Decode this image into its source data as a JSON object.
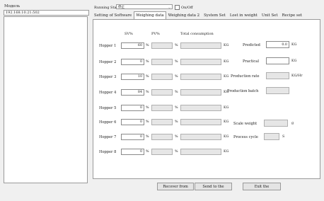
{
  "left": {
    "title": "Модель",
    "ip": "192.168.10.21:502"
  },
  "top": {
    "running_status_label": "Running Status",
    "running_status_value": "停止",
    "onoff_label": "On/Off"
  },
  "tabs": [
    {
      "label": "Setting of Software",
      "active": false
    },
    {
      "label": "Weighing data",
      "active": true
    },
    {
      "label": "Weighing data 2",
      "active": false
    },
    {
      "label": "System Set",
      "active": false
    },
    {
      "label": "Lost in weight",
      "active": false
    },
    {
      "label": "Unit Set",
      "active": false
    },
    {
      "label": "Recipe set",
      "active": false
    }
  ],
  "weighing": {
    "col_sv": "SV%",
    "col_pv": "PV%",
    "col_total": "Total consumption",
    "pct_unit": "%",
    "kg_unit": "KG",
    "hoppers": [
      {
        "name": "Hopper 1",
        "sv": "60"
      },
      {
        "name": "Hopper 2",
        "sv": "0"
      },
      {
        "name": "Hopper 3",
        "sv": "10"
      },
      {
        "name": "Hopper 4",
        "sv": "84"
      },
      {
        "name": "Hopper 5",
        "sv": "0"
      },
      {
        "name": "Hopper 6",
        "sv": "0"
      },
      {
        "name": "Hopper 7",
        "sv": "0"
      },
      {
        "name": "Hopper 8",
        "sv": "0"
      }
    ]
  },
  "right": {
    "predicted_label": "Predicted",
    "predicted_value": "0.0",
    "predicted_unit": "KG",
    "practical_label": "Practical",
    "practical_unit": "KG",
    "production_rate_label": "Production rate",
    "production_rate_unit": "KG/Hr",
    "production_batch_label": "Production batch",
    "scale_weight_label": "Scale weight",
    "scale_weight_unit": "g",
    "process_cycle_label": "Process cycle",
    "process_cycle_unit": "S"
  },
  "buttons": {
    "recover": "Recover from",
    "send": "Send to the",
    "exit": "Exit the"
  }
}
